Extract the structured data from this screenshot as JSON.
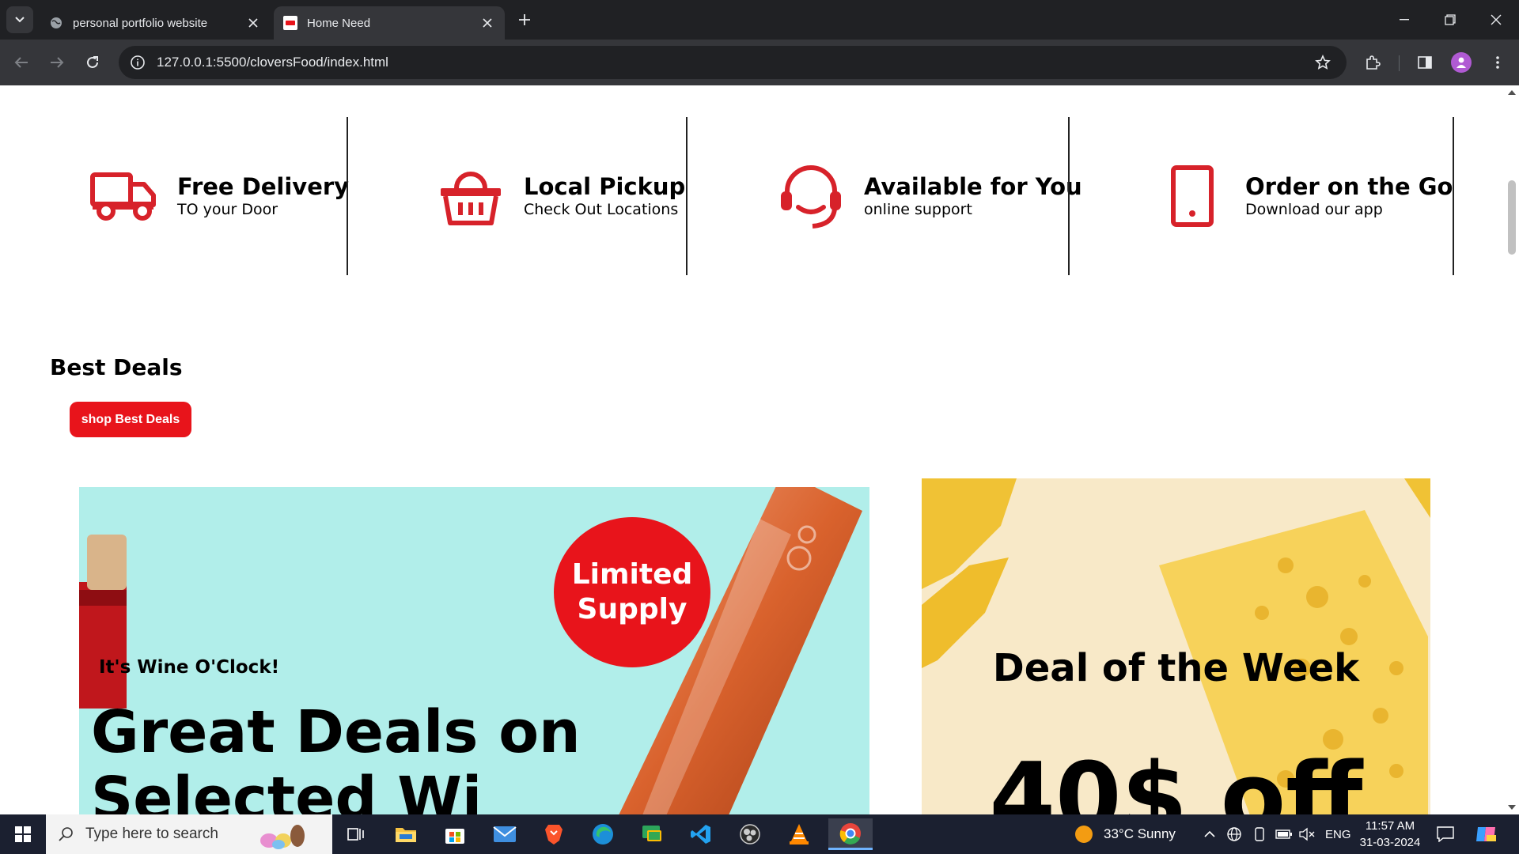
{
  "browser": {
    "tabs": [
      {
        "title": "personal portfolio website",
        "active": false
      },
      {
        "title": "Home Need",
        "active": true
      }
    ],
    "url": "127.0.0.1:5500/cloversFood/index.html"
  },
  "features": [
    {
      "title": "Free Delivery",
      "subtitle": "TO your Door",
      "icon": "truck-icon"
    },
    {
      "title": "Local Pickup",
      "subtitle": "Check Out Locations",
      "icon": "basket-icon"
    },
    {
      "title": "Available for You",
      "subtitle": "online support",
      "icon": "headset-icon"
    },
    {
      "title": "Order on the Go",
      "subtitle": "Download our app",
      "icon": "phone-icon"
    }
  ],
  "best_deals": {
    "title": "Best Deals",
    "button": "shop Best Deals"
  },
  "promo_wine": {
    "badge_line1": "Limited",
    "badge_line2": "Supply",
    "kicker": "It's Wine O'Clock!",
    "headline": "Great Deals on",
    "headline2": "Selected Wi"
  },
  "promo_sponge": {
    "kicker": "Deal of the Week",
    "headline": "40$ off"
  },
  "taskbar": {
    "search_placeholder": "Type here to search",
    "weather": "33°C  Sunny",
    "language": "ENG",
    "time": "11:57 AM",
    "date": "31-03-2024"
  },
  "colors": {
    "accent_red": "#e8141b",
    "wine_bg": "#b1eeea",
    "sponge_bg": "#f8e9c8"
  }
}
